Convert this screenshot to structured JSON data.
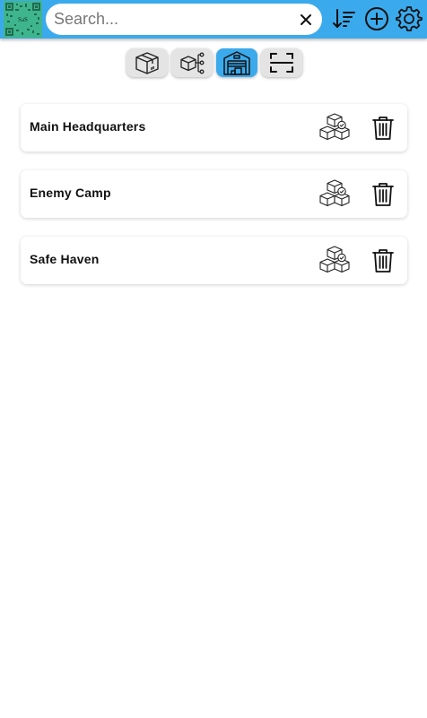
{
  "logo": {
    "text": "SaS"
  },
  "search": {
    "placeholder": "Search...",
    "value": ""
  },
  "toolbar": {
    "icons": [
      "clear-icon",
      "sort-icon",
      "add-circle-icon",
      "gear-icon"
    ]
  },
  "tabs": [
    {
      "icon": "box-icon",
      "active": false
    },
    {
      "icon": "box-network-icon",
      "active": false
    },
    {
      "icon": "warehouse-icon",
      "active": true
    },
    {
      "icon": "scan-icon",
      "active": false
    }
  ],
  "locations": [
    {
      "name": "Main Headquarters"
    },
    {
      "name": "Enemy Camp"
    },
    {
      "name": "Safe Haven"
    }
  ],
  "colors": {
    "accent": "#3baaec",
    "logo_bg": "#3fb58e",
    "tab_bg": "#e4e4e4"
  }
}
